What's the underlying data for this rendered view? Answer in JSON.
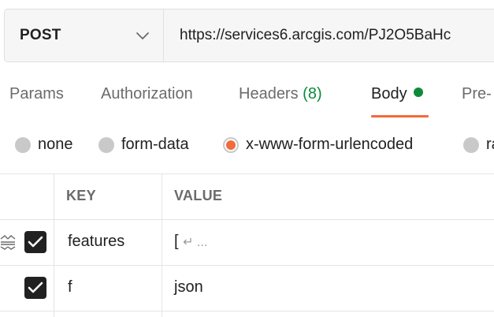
{
  "request": {
    "method": "POST",
    "url": "https://services6.arcgis.com/PJ2O5BaHc"
  },
  "tabs": {
    "params": "Params",
    "authorization": "Authorization",
    "headers": "Headers",
    "headers_count": "(8)",
    "body": "Body",
    "pre": "Pre-"
  },
  "body_types": {
    "none": "none",
    "form_data": "form-data",
    "urlencoded": "x-www-form-urlencoded",
    "raw": "ra",
    "selected": "x-www-form-urlencoded"
  },
  "table": {
    "headers": {
      "key": "KEY",
      "value": "VALUE"
    },
    "rows": [
      {
        "key": "features",
        "value": "[",
        "value_more": "↵ ...",
        "checked": true
      },
      {
        "key": "f",
        "value": "json",
        "checked": true
      }
    ]
  },
  "colors": {
    "accent": "#f26b3a",
    "active_dot": "#0f8a39",
    "headers_count": "#0b8a3a"
  }
}
